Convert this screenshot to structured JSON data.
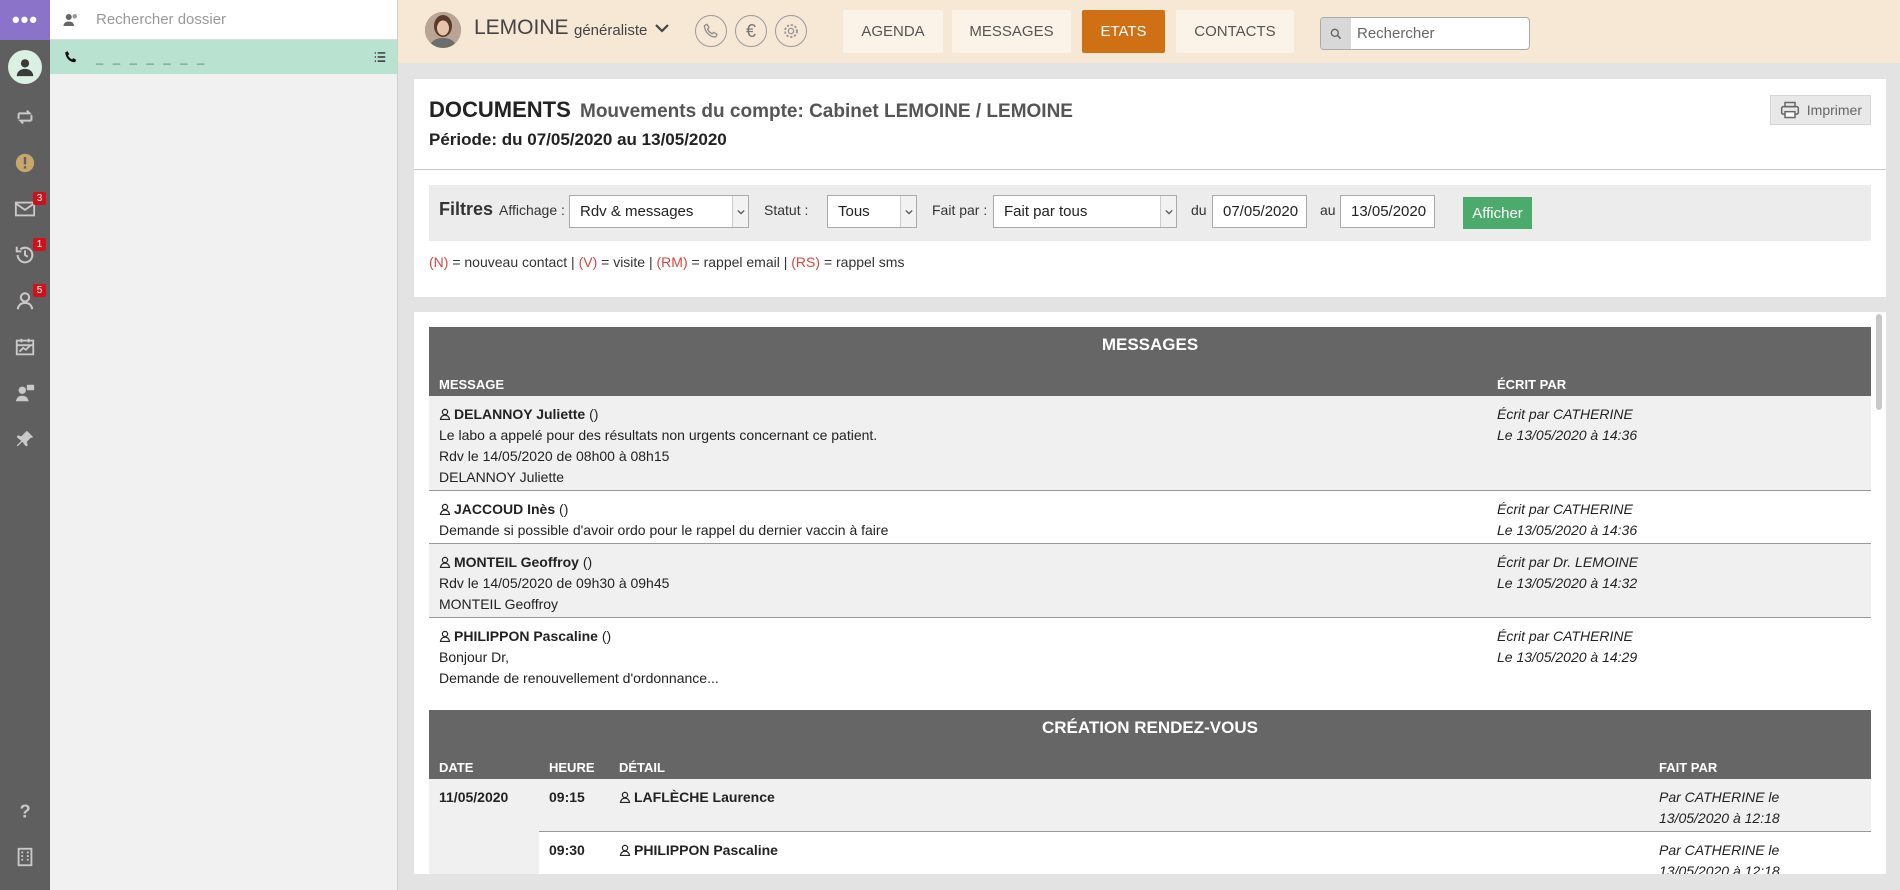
{
  "app": {
    "menu_icon": "dots-icon",
    "badges": {
      "messages": "3",
      "reminders": "1",
      "contacts": "5"
    }
  },
  "panel": {
    "search_placeholder": "Rechercher dossier",
    "call_row_text": "_ _ _ _ _ _ _"
  },
  "topbar": {
    "doctor_name": "LEMOINE",
    "doctor_specialty": "généraliste",
    "tabs": [
      {
        "label": "AGENDA"
      },
      {
        "label": "MESSAGES"
      },
      {
        "label": "ETATS"
      },
      {
        "label": "CONTACTS"
      }
    ],
    "active_tab": "ETATS",
    "search_placeholder": "Rechercher",
    "euro_symbol": "€"
  },
  "documents": {
    "title": "DOCUMENTS",
    "subtitle": "Mouvements du compte: Cabinet LEMOINE / LEMOINE",
    "period_prefix": "Période: du",
    "period_from": "07/05/2020",
    "period_mid": "au",
    "period_to": "13/05/2020",
    "print_label": "Imprimer"
  },
  "filters": {
    "title": "Filtres",
    "affichage_label": "Affichage :",
    "affichage_value": "Rdv & messages",
    "statut_label": "Statut :",
    "statut_value": "Tous",
    "faitpar_label": "Fait par :",
    "faitpar_value": "Fait par tous",
    "du_label": "du",
    "du_value": "07/05/2020",
    "au_label": "au",
    "au_value": "13/05/2020",
    "submit_label": "Afficher"
  },
  "legend": {
    "n_code": "(N)",
    "n_text": "= nouveau contact |",
    "v_code": "(V)",
    "v_text": "= visite |",
    "rm_code": "(RM)",
    "rm_text": "= rappel email |",
    "rs_code": "(RS)",
    "rs_text": "= rappel sms"
  },
  "messages": {
    "title": "MESSAGES",
    "col_message": "MESSAGE",
    "col_author": "ÉCRIT PAR",
    "rows": [
      {
        "name": "DELANNOY Juliette",
        "suffix": " ()",
        "lines": [
          "Le labo a appelé pour des résultats non urgents concernant ce patient.",
          "Rdv le 14/05/2020 de 08h00 à 08h15",
          "DELANNOY Juliette"
        ],
        "author": "Écrit par CATHERINE",
        "date": "Le 13/05/2020 à 14:36"
      },
      {
        "name": "JACCOUD Inès",
        "suffix": " ()",
        "lines": [
          "Demande si possible d'avoir ordo pour le rappel du dernier vaccin à faire"
        ],
        "author": "Écrit par CATHERINE",
        "date": "Le 13/05/2020 à 14:36"
      },
      {
        "name": "MONTEIL Geoffroy",
        "suffix": " ()",
        "lines": [
          "Rdv le 14/05/2020 de 09h30 à 09h45",
          "MONTEIL Geoffroy"
        ],
        "author": "Écrit par Dr. LEMOINE",
        "date": "Le 13/05/2020 à 14:32"
      },
      {
        "name": "PHILIPPON Pascaline",
        "suffix": " ()",
        "lines": [
          "Bonjour Dr,",
          "Demande de renouvellement d'ordonnance..."
        ],
        "author": "Écrit par CATHERINE",
        "date": "Le 13/05/2020 à 14:29"
      }
    ]
  },
  "rdv": {
    "title": "CRÉATION RENDEZ-VOUS",
    "col_date": "DATE",
    "col_time": "HEURE",
    "col_detail": "DÉTAIL",
    "col_by": "FAIT PAR",
    "rows": [
      {
        "date": "11/05/2020",
        "time": "09:15",
        "name": "LAFLÈCHE Laurence",
        "by1": "Par CATHERINE le",
        "by2": "13/05/2020 à 12:18"
      },
      {
        "date": "",
        "time": "09:30",
        "name": "PHILIPPON Pascaline",
        "by1": "Par CATHERINE le",
        "by2": "13/05/2020 à 12:18"
      }
    ]
  }
}
